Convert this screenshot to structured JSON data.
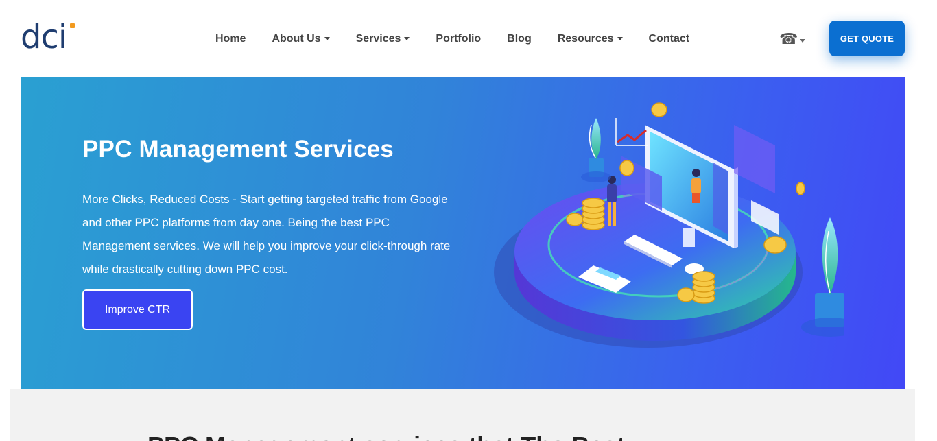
{
  "header": {
    "logo_text": "dci",
    "nav": [
      {
        "label": "Home",
        "dropdown": false
      },
      {
        "label": "About Us",
        "dropdown": true
      },
      {
        "label": "Services",
        "dropdown": true
      },
      {
        "label": "Portfolio",
        "dropdown": false
      },
      {
        "label": "Blog",
        "dropdown": false
      },
      {
        "label": "Resources",
        "dropdown": true
      },
      {
        "label": "Contact",
        "dropdown": false
      }
    ],
    "phone_icon": "phone-icon",
    "quote_label": "GET QUOTE"
  },
  "hero": {
    "title": "PPC Management Services",
    "description": "More Clicks, Reduced Costs - Start getting targeted traffic from Google and other PPC platforms from day one. Being the best PPC Management services. We will help you improve your click-through rate while drastically cutting down PPC cost.",
    "cta_label": "Improve CTR",
    "illustration": "isometric-ppc-illustration"
  },
  "lower": {
    "heading": "PPC Management services that The Best"
  },
  "colors": {
    "brand_navy": "#1f3d70",
    "brand_orange": "#f29a1f",
    "quote_button": "#0b6fd1",
    "cta_button": "#3a44f2",
    "hero_gradient_start": "#2aa0d2",
    "hero_gradient_end": "#4248f6"
  }
}
